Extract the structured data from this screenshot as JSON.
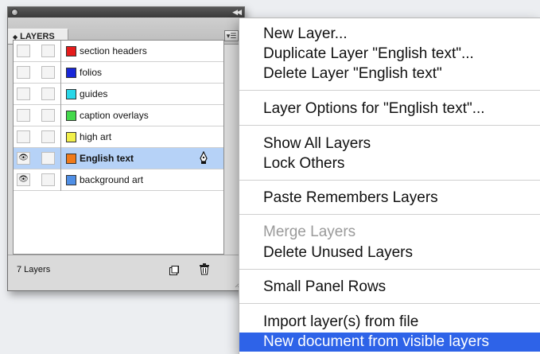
{
  "panel": {
    "tab_label": "LAYERS",
    "layers": [
      {
        "name": "section headers",
        "color": "#e51b1b",
        "visible": false,
        "selected": false
      },
      {
        "name": "folios",
        "color": "#1826d8",
        "visible": false,
        "selected": false
      },
      {
        "name": "guides",
        "color": "#29d7e8",
        "visible": false,
        "selected": false
      },
      {
        "name": "caption overlays",
        "color": "#44d94c",
        "visible": false,
        "selected": false
      },
      {
        "name": "high art",
        "color": "#f2f04a",
        "visible": false,
        "selected": false
      },
      {
        "name": "English text",
        "color": "#f07a1a",
        "visible": true,
        "selected": true
      },
      {
        "name": "background art",
        "color": "#4f8fe6",
        "visible": true,
        "selected": false
      }
    ],
    "footer": {
      "count_label": "7 Layers"
    }
  },
  "menu": {
    "items": [
      {
        "label": "New Layer...",
        "state": "normal"
      },
      {
        "label": "Duplicate Layer \"English text\"...",
        "state": "normal"
      },
      {
        "label": "Delete Layer \"English text\"",
        "state": "normal"
      },
      {
        "label": "Layer Options for \"English text\"...",
        "state": "normal"
      },
      {
        "label": "Show All Layers",
        "state": "normal"
      },
      {
        "label": "Lock Others",
        "state": "normal"
      },
      {
        "label": "Paste Remembers Layers",
        "state": "normal"
      },
      {
        "label": "Merge Layers",
        "state": "disabled"
      },
      {
        "label": "Delete Unused Layers",
        "state": "normal"
      },
      {
        "label": "Small Panel Rows",
        "state": "normal"
      },
      {
        "label": "Import layer(s) from file",
        "state": "normal"
      },
      {
        "label": "New document from visible layers",
        "state": "highlighted"
      }
    ]
  },
  "colors": {
    "highlight": "#2e63e8",
    "selected_row": "#b6d2f7"
  }
}
